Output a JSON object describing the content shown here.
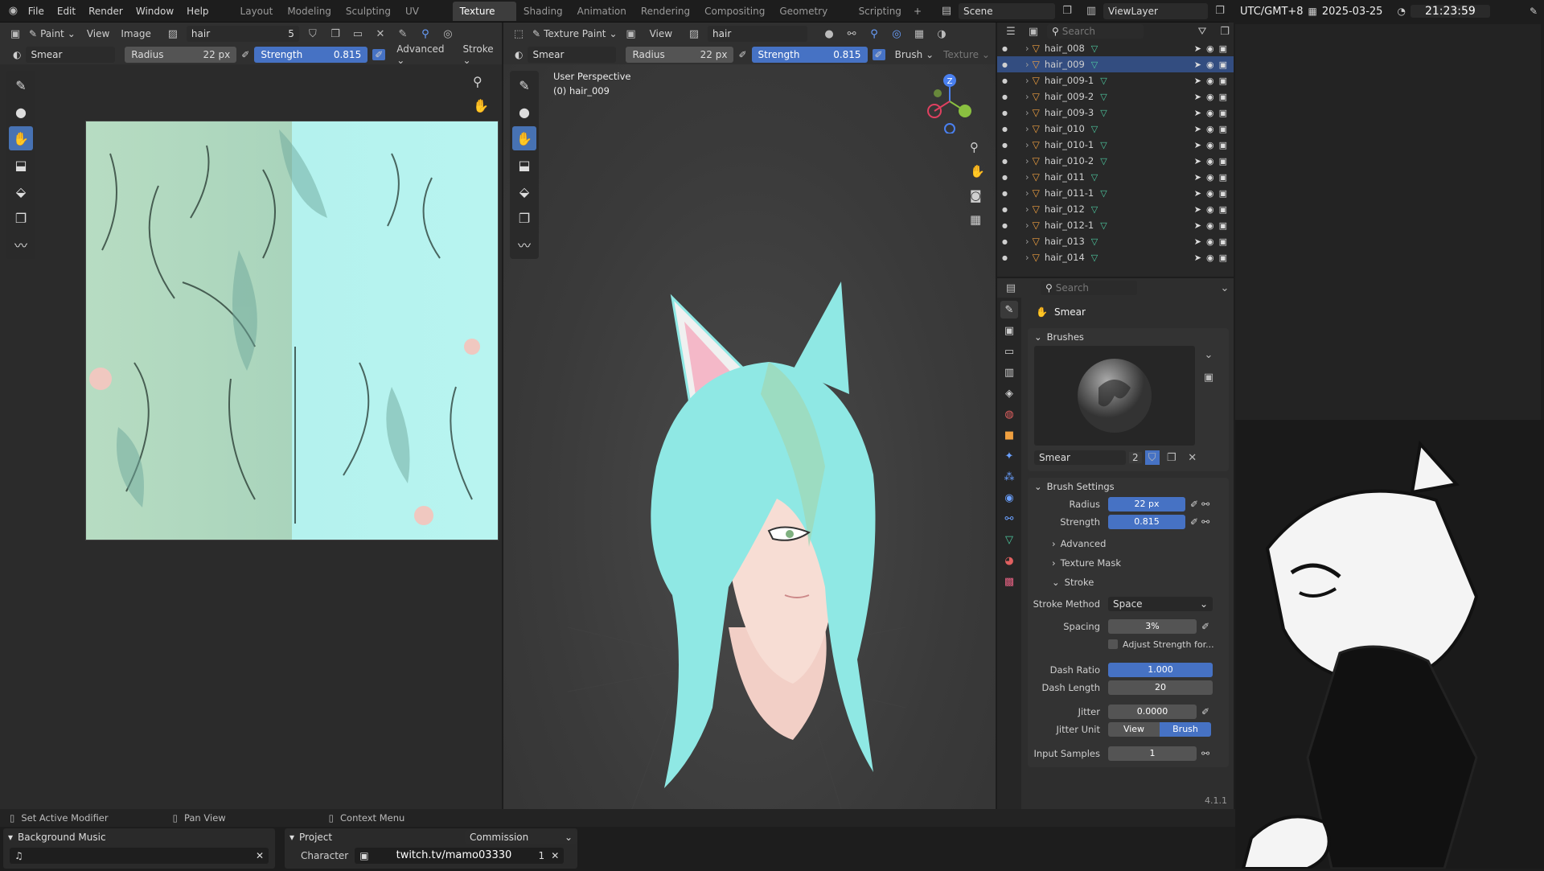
{
  "topbar": {
    "menus": [
      "File",
      "Edit",
      "Render",
      "Window",
      "Help"
    ],
    "workspaces": [
      "Layout",
      "Modeling",
      "Sculpting",
      "UV Editing",
      "Texture Paint",
      "Shading",
      "Animation",
      "Rendering",
      "Compositing",
      "Geometry Nodes",
      "Scripting"
    ],
    "active_workspace": "Texture Paint",
    "scene": "Scene",
    "view_layer": "ViewLayer",
    "add_symbol": "+"
  },
  "clock": {
    "timezone": "UTC/GMT+8",
    "date": "2025-03-25",
    "time": "21:23:59"
  },
  "image_editor": {
    "mode": "Paint",
    "view": "View",
    "image_menu": "Image",
    "image_name": "hair",
    "users": "5",
    "tool_name": "Smear",
    "radius_label": "Radius",
    "radius_value": "22 px",
    "strength_label": "Strength",
    "strength_value": "0.815",
    "advanced": "Advanced",
    "stroke": "Stroke"
  },
  "viewport": {
    "mode": "Texture Paint",
    "view": "View",
    "image_name": "hair",
    "tool_name": "Smear",
    "radius_label": "Radius",
    "radius_value": "22 px",
    "strength_label": "Strength",
    "strength_value": "0.815",
    "brush": "Brush",
    "texture": "Texture",
    "perspective": "User Perspective",
    "object": "(0) hair_009",
    "axis_z": "Z"
  },
  "outliner": {
    "search_placeholder": "Search",
    "items": [
      {
        "name": "hair_008",
        "selected": false
      },
      {
        "name": "hair_009",
        "selected": true
      },
      {
        "name": "hair_009-1",
        "selected": false
      },
      {
        "name": "hair_009-2",
        "selected": false
      },
      {
        "name": "hair_009-3",
        "selected": false
      },
      {
        "name": "hair_010",
        "selected": false
      },
      {
        "name": "hair_010-1",
        "selected": false
      },
      {
        "name": "hair_010-2",
        "selected": false
      },
      {
        "name": "hair_011",
        "selected": false
      },
      {
        "name": "hair_011-1",
        "selected": false
      },
      {
        "name": "hair_012",
        "selected": false
      },
      {
        "name": "hair_012-1",
        "selected": false
      },
      {
        "name": "hair_013",
        "selected": false
      },
      {
        "name": "hair_014",
        "selected": false
      }
    ]
  },
  "properties": {
    "search_placeholder": "Search",
    "tool_title": "Smear",
    "brushes_header": "Brushes",
    "brush_name": "Smear",
    "brush_users": "2",
    "brush_settings_header": "Brush Settings",
    "radius_label": "Radius",
    "radius_value": "22 px",
    "strength_label": "Strength",
    "strength_value": "0.815",
    "advanced": "Advanced",
    "texture_mask": "Texture Mask",
    "stroke": "Stroke",
    "stroke_method_label": "Stroke Method",
    "stroke_method_value": "Space",
    "spacing_label": "Spacing",
    "spacing_value": "3%",
    "adjust_strength": "Adjust Strength for...",
    "dash_ratio_label": "Dash Ratio",
    "dash_ratio_value": "1.000",
    "dash_length_label": "Dash Length",
    "dash_length_value": "20",
    "jitter_label": "Jitter",
    "jitter_value": "0.0000",
    "jitter_unit_label": "Jitter Unit",
    "jitter_unit_options": [
      "View",
      "Brush"
    ],
    "jitter_unit_selected": "Brush",
    "input_samples_label": "Input Samples",
    "input_samples_value": "1",
    "version": "4.1.1"
  },
  "statusbar": {
    "left": "Set Active Modifier",
    "middle": "Pan View",
    "right": "Context Menu"
  },
  "bottom_panels": {
    "music_header": "Background Music",
    "project_header": "Project",
    "project_value": "Commission",
    "character_label": "Character",
    "character_value": "twitch.tv/mamo03330",
    "character_count": "1"
  },
  "colors": {
    "accent": "#4672c4",
    "selection": "#334d80",
    "mesh": "#4ec9a0",
    "object": "#f0a040",
    "hair": "#8fe8e4"
  }
}
